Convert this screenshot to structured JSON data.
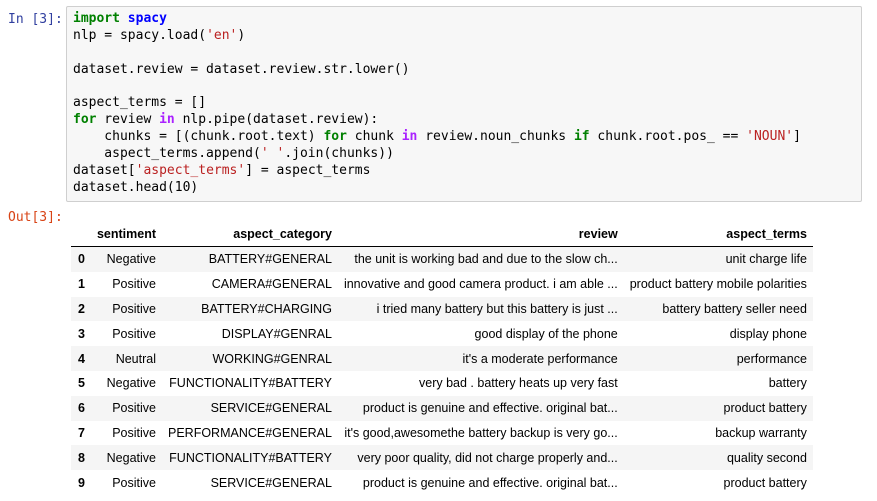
{
  "cell": {
    "in_prompt": "In [3]:",
    "out_prompt": "Out[3]:",
    "code_lines": [
      [
        {
          "t": "import",
          "c": "kw"
        },
        {
          "t": " "
        },
        {
          "t": "spacy",
          "c": "mod"
        }
      ],
      [
        {
          "t": "nlp = spacy.load("
        },
        {
          "t": "'en'",
          "c": "str"
        },
        {
          "t": ")"
        }
      ],
      [],
      [
        {
          "t": "dataset.review = dataset.review.str.lower()"
        }
      ],
      [],
      [
        {
          "t": "aspect_terms = []"
        }
      ],
      [
        {
          "t": "for",
          "c": "kw"
        },
        {
          "t": " review "
        },
        {
          "t": "in",
          "c": "op"
        },
        {
          "t": " nlp.pipe(dataset.review):"
        }
      ],
      [
        {
          "t": "    chunks = [(chunk.root.text) "
        },
        {
          "t": "for",
          "c": "kw"
        },
        {
          "t": " chunk "
        },
        {
          "t": "in",
          "c": "op"
        },
        {
          "t": " review.noun_chunks "
        },
        {
          "t": "if",
          "c": "kw"
        },
        {
          "t": " chunk.root.pos_ == "
        },
        {
          "t": "'NOUN'",
          "c": "str"
        },
        {
          "t": "]"
        }
      ],
      [
        {
          "t": "    aspect_terms.append("
        },
        {
          "t": "' '",
          "c": "str"
        },
        {
          "t": ".join(chunks))"
        }
      ],
      [
        {
          "t": "dataset["
        },
        {
          "t": "'aspect_terms'",
          "c": "str"
        },
        {
          "t": "] = aspect_terms"
        }
      ],
      [
        {
          "t": "dataset.head(10)"
        }
      ]
    ]
  },
  "table": {
    "columns": [
      "",
      "sentiment",
      "aspect_category",
      "review",
      "aspect_terms"
    ],
    "rows": [
      [
        "0",
        "Negative",
        "BATTERY#GENERAL",
        "the unit is working bad and due to the slow ch...",
        "unit charge life"
      ],
      [
        "1",
        "Positive",
        "CAMERA#GENERAL",
        "innovative and good camera product. i am able ...",
        "product battery mobile polarities"
      ],
      [
        "2",
        "Positive",
        "BATTERY#CHARGING",
        "i tried many battery but this battery is just ...",
        "battery battery seller need"
      ],
      [
        "3",
        "Positive",
        "DISPLAY#GENRAL",
        "good display of the phone",
        "display phone"
      ],
      [
        "4",
        "Neutral",
        "WORKING#GENRAL",
        "it's a moderate performance",
        "performance"
      ],
      [
        "5",
        "Negative",
        "FUNCTIONALITY#BATTERY",
        "very bad . battery heats up very fast",
        "battery"
      ],
      [
        "6",
        "Positive",
        "SERVICE#GENERAL",
        "product is genuine and effective. original bat...",
        "product battery"
      ],
      [
        "7",
        "Positive",
        "PERFORMANCE#GENERAL",
        "it's good,awesomethe battery backup is very go...",
        "backup warranty"
      ],
      [
        "8",
        "Negative",
        "FUNCTIONALITY#BATTERY",
        "very poor quality, did not charge properly and...",
        "quality second"
      ],
      [
        "9",
        "Positive",
        "SERVICE#GENERAL",
        "product is genuine and effective. original bat...",
        "product battery"
      ]
    ]
  }
}
